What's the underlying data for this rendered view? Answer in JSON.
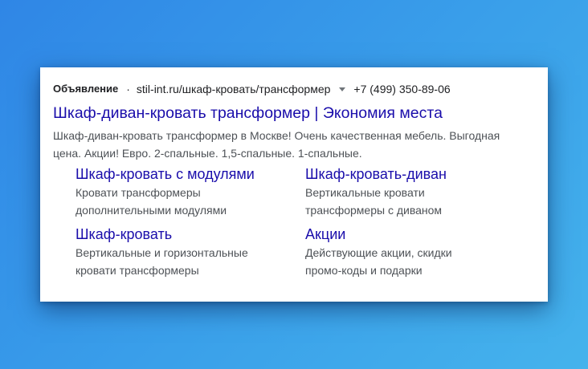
{
  "ad": {
    "badge": "Объявление",
    "separator": "·",
    "display_url": "stil-int.ru/шкаф-кровать/трансформер",
    "phone": "+7 (499) 350-89-06",
    "title": "Шкаф-диван-кровать трансформер | Экономия места",
    "description_line1": "Шкаф-диван-кровать трансформер в Москве! Очень качественная мебель. Выгодная",
    "description_line2": "цена. Акции! Евро. 2-спальные. 1,5-спальные. 1-спальные."
  },
  "sitelinks": [
    {
      "title": "Шкаф-кровать с модулями",
      "desc_line1": "Кровати трансформеры",
      "desc_line2": "дополнительными модулями"
    },
    {
      "title": "Шкаф-кровать-диван",
      "desc_line1": "Вертикальные кровати",
      "desc_line2": "трансформеры с диваном"
    },
    {
      "title": "Шкаф-кровать",
      "desc_line1": "Вертикальные и горизонтальные",
      "desc_line2": "кровати трансформеры"
    },
    {
      "title": "Акции",
      "desc_line1": "Действующие акции, скидки",
      "desc_line2": "промо-коды и подарки"
    }
  ],
  "colors": {
    "link": "#1a0dab",
    "text": "#202124",
    "snippet": "#4d5156",
    "background_start": "#2f86e6",
    "background_end": "#45b3ec"
  },
  "icons": {
    "url_menu": "dropdown-arrow-icon"
  }
}
